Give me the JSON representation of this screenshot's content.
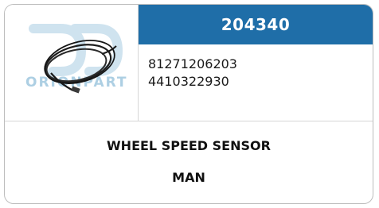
{
  "part": {
    "code": "204340",
    "references": [
      "81271206203",
      "4410322930"
    ],
    "name": "WHEEL SPEED SENSOR",
    "brand": "MAN"
  },
  "watermark": {
    "text": "ORIONPART"
  },
  "colors": {
    "header_bg": "#1f6ea8",
    "watermark": "#9fc7df",
    "border": "#bdbdbd"
  },
  "icons": {
    "product_image": "sensor-cable-icon",
    "logo": "orionpart-logo-icon"
  }
}
